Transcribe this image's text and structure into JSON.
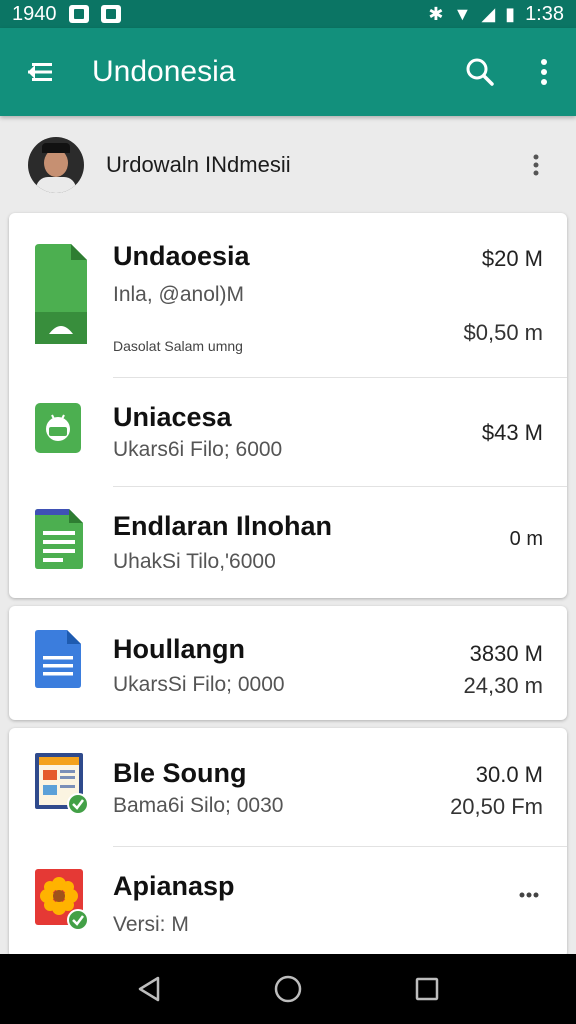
{
  "status_bar": {
    "time_left": "1940",
    "time_right": "1:38"
  },
  "app_bar": {
    "title": "Undonesia"
  },
  "account": {
    "name": "Urdowaln INdmesii"
  },
  "cards": [
    {
      "items": [
        {
          "title": "Undaoesia",
          "subtitle": "Inla, @anol)M",
          "detail": "Dasolat Salam umng",
          "value1": "$20 M",
          "value2": "$0,50 m",
          "icon": "green-file-icon"
        },
        {
          "title": "Uniacesa",
          "subtitle": "Ukars6i Filo; 6000",
          "value1": "$43 M",
          "icon": "green-android-app-icon"
        },
        {
          "title": "Endlaran Ilnohan",
          "subtitle": "UhakSi Tilo,'6000",
          "value1": "0 m",
          "icon": "green-sheets-doc-icon"
        }
      ]
    },
    {
      "items": [
        {
          "title": "Houllangn",
          "subtitle": "UkarsSi Filo; 0000",
          "value1": "3830 M",
          "value2": "24,30 m",
          "icon": "blue-doc-icon"
        }
      ]
    },
    {
      "items": [
        {
          "title": "Ble Soung",
          "subtitle": "Bama6i Silo; 0030",
          "value1": "30.0 M",
          "value2": "20,50 Fm",
          "icon": "slides-app-checked-icon"
        },
        {
          "title": "Apianasp",
          "subtitle": "Versi: M",
          "icon": "flower-app-checked-icon"
        }
      ]
    }
  ],
  "colors": {
    "status_bar": "#0b7564",
    "app_bar": "#12907c",
    "background": "#ebebeb",
    "green_icon": "#4caf50",
    "blue_icon": "#3b7ddd"
  }
}
